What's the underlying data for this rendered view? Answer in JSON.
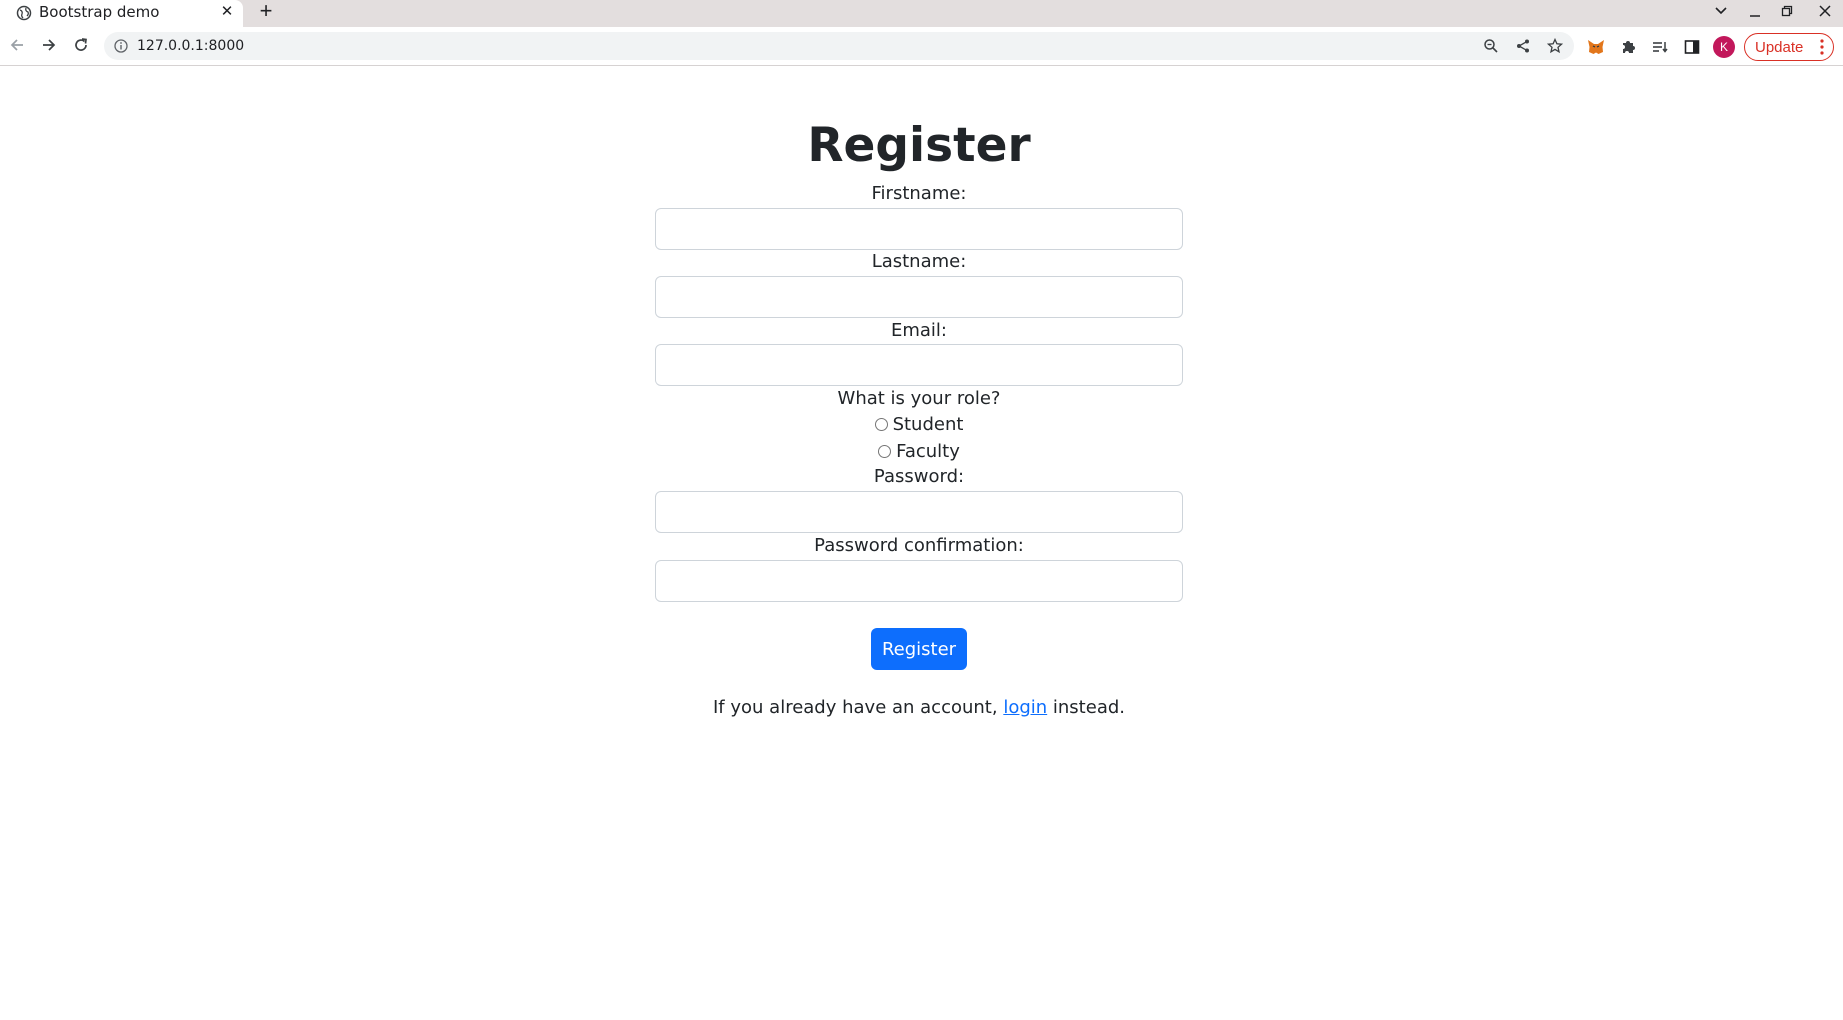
{
  "browser": {
    "tab_title": "Bootstrap demo",
    "url": "127.0.0.1:8000",
    "profile_initial": "K",
    "update_label": "Update",
    "accent_update": "#d93025",
    "avatar_color": "#c2185b"
  },
  "page": {
    "title": "Register",
    "fields": {
      "firstname_label": "Firstname:",
      "lastname_label": "Lastname:",
      "email_label": "Email:",
      "role_label": "What is your role?",
      "role_options": [
        "Student",
        "Faculty"
      ],
      "password_label": "Password:",
      "password_confirm_label": "Password confirmation:"
    },
    "submit_label": "Register",
    "footer": {
      "prefix": "If you already have an account, ",
      "link": "login",
      "suffix": " instead."
    },
    "primary_color": "#0d6efd"
  }
}
